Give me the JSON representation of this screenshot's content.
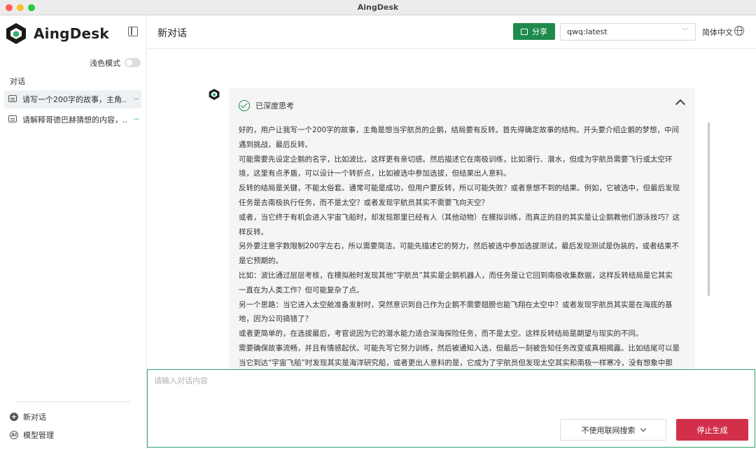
{
  "window": {
    "title": "AingDesk"
  },
  "sidebar": {
    "brand": "AingDesk",
    "theme_label": "浅色模式",
    "section_title": "对话",
    "conversations": [
      {
        "title": "请写一个200字的故事，主角...",
        "more": "···"
      },
      {
        "title": "请解释哥德巴赫猜想的内容，...",
        "more": "···"
      }
    ],
    "footer": {
      "new_chat": "新对话",
      "model_manage": "模型管理"
    }
  },
  "header": {
    "title": "新对话",
    "share_label": "分享",
    "model": "qwq:latest",
    "language": "简体中文"
  },
  "chat": {
    "think_status": "已深度思考",
    "paragraphs": [
      "好的，用户让我写一个200字的故事，主角是想当宇航员的企鹅，结局要有反转。首先得确定故事的结构。开头要介绍企鹅的梦想，中间遇到挑战，最后反转。",
      "可能需要先设定企鹅的名字，比如波比，这样更有亲切感。然后描述它在南极训练，比如滑行、潜水，但成为宇航员需要飞行或太空环境，这里有点矛盾，可以设计一个转折点，比如被选中参加选拔，但结果出人意料。",
      "反转的结局是关键，不能太俗套。通常可能是成功，但用户要反转，所以可能失败？或者意想不到的结果。例如，它被选中，但最后发现任务是去南极执行任务，而不是太空？或者发现宇航员其实不需要飞向天空？",
      "或者，当它终于有机会进入宇宙飞船时，却发现那里已经有人（其他动物）在模拟训练，而真正的目的其实是让企鹅教他们游泳技巧？这样反转。",
      "另外要注意字数限制200字左右，所以需要简洁。可能先描述它的努力，然后被选中参加选拔测试，最后发现测试是伪装的，或者结果不是它预期的。",
      "比如：波比通过层层考核，在模拟舱时发现其他“宇航员”其实是企鹅机器人，而任务是让它回到南极收集数据，这样反转结局是它其实一直在为人类工作？但可能复杂了点。",
      "另一个思路：当它进入太空舱准备发射时，突然意识到自己作为企鹅不需要翅膀也能飞翔在太空中？或者发现宇航员其实是在海底的基地，因为公司搞错了？",
      "或者更简单的，在选拔最后，考官说因为它的潜水能力适合深海探险任务，而不是太空。这样反转结局是期望与现实的不同。",
      "需要确保故事流畅，并且有情感起伏。可能先写它努力训练，然后被通知入选，但最后一刻被告知任务改变或真相揭露。比如结尾可以是当它到达“宇宙飞船”时发现其实是海洋研究船，或者更出人意料的是，它成为了宇航员但发现太空其实和南极一样寒冷，没有想象中那么"
    ]
  },
  "composer": {
    "placeholder": "请输入对话内容",
    "web_search_label": "不使用联网搜索",
    "stop_label": "停止生成"
  },
  "colors": {
    "accent": "#1f8a4d",
    "stop": "#d2304a"
  }
}
